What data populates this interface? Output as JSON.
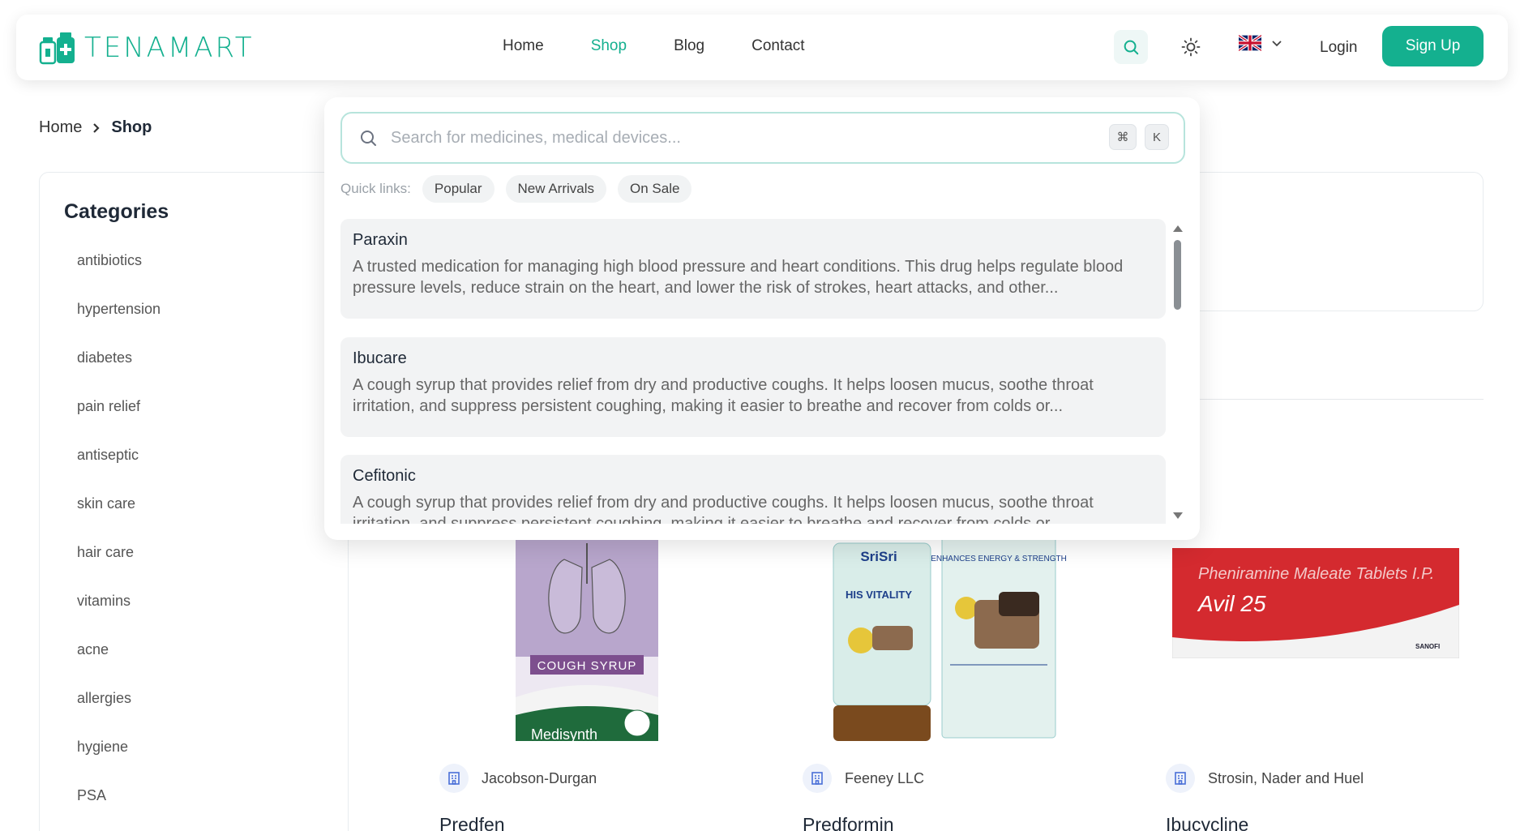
{
  "header": {
    "brand": "TENAMART",
    "nav": [
      "Home",
      "Shop",
      "Blog",
      "Contact"
    ],
    "active_nav": "Shop",
    "login": "Login",
    "signup": "Sign Up",
    "accent_color": "#14b08f"
  },
  "breadcrumb": {
    "home": "Home",
    "current": "Shop"
  },
  "sidebar": {
    "title": "Categories",
    "categories": [
      "antibiotics",
      "hypertension",
      "diabetes",
      "pain relief",
      "antiseptic",
      "skin care",
      "hair care",
      "vitamins",
      "acne",
      "allergies",
      "hygiene",
      "PSA"
    ]
  },
  "search": {
    "placeholder": "Search for medicines, medical devices...",
    "kbd_cmd": "⌘",
    "kbd_k": "K",
    "quick_label": "Quick links:",
    "quick_links": [
      "Popular",
      "New Arrivals",
      "On Sale"
    ],
    "results": [
      {
        "title": "Paraxin",
        "desc": "A trusted medication for managing high blood pressure and heart conditions. This drug helps regulate blood pressure levels, reduce strain on the heart, and lower the risk of strokes, heart attacks, and other..."
      },
      {
        "title": "Ibucare",
        "desc": "A cough syrup that provides relief from dry and productive coughs. It helps loosen mucus, soothe throat irritation, and suppress persistent coughing, making it easier to breathe and recover from colds or..."
      },
      {
        "title": "Cefitonic",
        "desc": "A cough syrup that provides relief from dry and productive coughs. It helps loosen mucus, soothe throat irritation, and suppress persistent coughing, making it easier to breathe and recover from colds or..."
      }
    ]
  },
  "products": [
    {
      "manufacturer": "Jacobson-Durgan",
      "name": "Predfen",
      "img_text": "COUGH SYRUP",
      "img_brand": "Medisynth"
    },
    {
      "manufacturer": "Feeney LLC",
      "name": "Predformin",
      "img_brand": "SriSri",
      "img_text": "HIS VITALITY",
      "img_sub": "ENHANCES ENERGY & STRENGTH"
    },
    {
      "manufacturer": "Strosin, Nader and Huel",
      "name": "Ibucycline",
      "img_text": "Pheniramine Maleate Tablets I.P.",
      "img_brand": "Avil 25",
      "img_maker": "SANOFI"
    }
  ]
}
